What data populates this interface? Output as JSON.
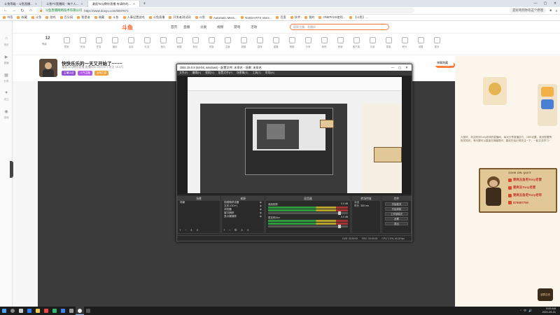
{
  "browser": {
    "tabs": [
      {
        "label": "斗鱼等级 - 斗鱼直播..."
      },
      {
        "label": "斗鱼TV直播网 - 每个人..."
      },
      {
        "label": "漫画Tony教你直播 有请你的..."
      }
    ],
    "new_tab": "+",
    "window_controls": [
      "—",
      "▢",
      "✕"
    ],
    "url_secure_label": "斗鱼直播网络技术有限公司",
    "url_address": "https://www.douyu.com/6937671",
    "right_pill": "是好奇到你有这个原理",
    "bookmarks": [
      "书签",
      "收藏",
      "斗鱼",
      "游戏",
      "百分网",
      "我是谁",
      "收藏",
      "斗鱼",
      "人事设置游戏",
      "斗鱼直播",
      "开发者测试网",
      "斗鱼",
      "Automatic Mess...",
      "NVIDIA RTX Voice...",
      "百度",
      "技术",
      "我的",
      "ONEPASS使用...",
      "【斗鱼】..."
    ]
  },
  "site": {
    "logo": "斗鱼",
    "nav": [
      "首页",
      "直播",
      "分类",
      "视频",
      "游戏",
      "活动"
    ],
    "search_placeholder": "搜索主播、直播间"
  },
  "gift_bar": {
    "level_number": "12",
    "level_label": "等级",
    "items": [
      "签到",
      "在线",
      "任务",
      "福利",
      "活动",
      "礼包",
      "鱼丸",
      "鱼翅",
      "粉丝",
      "贵族",
      "主播",
      "超管",
      "游戏",
      "直播",
      "视频",
      "分享",
      "鱼吧",
      "商城",
      "客户端",
      "手游",
      "赛事",
      "积分",
      "设置",
      "更多"
    ]
  },
  "anchor": {
    "title": "快快乐乐的一天又开始了~~~~",
    "subtitle": "漫画Tony教你直播  直播间ID 6937671  关注 16.5万",
    "tags": [
      "主播认证",
      "人气主播",
      "活动之星"
    ],
    "follow": "+ 关注",
    "fans": "粉丝团 加入"
  },
  "player": {
    "control_label": "弹幕隐藏"
  },
  "left_rail": {
    "labels": [
      "首页",
      "直播",
      "分类",
      "关注",
      "游戏"
    ]
  },
  "right_panel": {
    "intro": "大家好，欢迎来到Tony老师的直播间，每天分享直播技巧、OBS设置、推流配置等相关知识，有问题可以直接在弹幕提问，喜欢的话记得关注一下，一起交流学习~",
    "join_title": "JOIN ON QUIT",
    "join_rows": [
      "要爽去鱼吧Tony老营",
      "要爽去Tony老营",
      "要爽去鱼吧Tony老师",
      "879687790"
    ],
    "badge": "进群交流"
  },
  "obs": {
    "title": "OBS 25.0.8 (64-bit, windows) - 配置文件: 未命名 - 场景: 未命名",
    "menu": [
      "文件(F)",
      "编辑(E)",
      "视图(V)",
      "配置文件(P)",
      "场景集(S)",
      "工具(T)",
      "帮助(H)"
    ],
    "docks": {
      "scenes": {
        "head": "场景",
        "items": [
          "场景"
        ]
      },
      "sources": {
        "head": "来源",
        "items": [
          "视频捕获设备",
          "文本 (GDI+)",
          "浏览器",
          "窗口捕获",
          "显示器捕获"
        ]
      },
      "mixer": {
        "head": "混音器",
        "channels": [
          {
            "name": "桌面音频",
            "db": "0.0 dB"
          },
          {
            "name": "麦克风/Aux",
            "db": "0.0 dB"
          }
        ]
      },
      "transitions": {
        "head": "转场特效",
        "fade": "淡出",
        "duration_label": "时长",
        "duration": "300 ms"
      },
      "controls": {
        "head": "控件",
        "buttons": [
          "开始推流",
          "开始录制",
          "工作室模式",
          "设置",
          "退出"
        ]
      }
    },
    "status": [
      "LIVE: 00:00:00",
      "REC: 00:00:00",
      "CPU: 2.5%, 60.00 fps"
    ]
  },
  "taskbar": {
    "time": "9:09 AM",
    "date": "2021-09-21",
    "tray": [
      "^",
      "中",
      "🔊"
    ]
  }
}
